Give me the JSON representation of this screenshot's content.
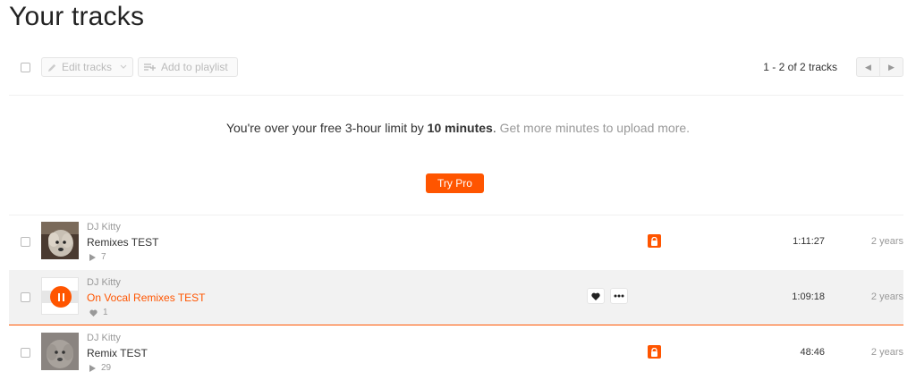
{
  "page": {
    "title": "Your tracks"
  },
  "toolbar": {
    "edit_tracks_label": "Edit tracks",
    "add_to_playlist_label": "Add to playlist",
    "count_label": "1 - 2 of 2 tracks"
  },
  "notice": {
    "prefix": "You're over your free 3-hour limit by ",
    "amount": "10 minutes",
    "suffix": ".",
    "link": "Get more minutes to upload more."
  },
  "cta": {
    "label": "Try Pro"
  },
  "colors": {
    "accent": "#ff5500",
    "muted": "#999999",
    "row_active_bg": "#f2f2f2"
  },
  "tracks": [
    {
      "artist": "DJ Kitty",
      "title": "Remixes TEST",
      "stat_icon": "play-icon",
      "stat": "7",
      "private": true,
      "duration": "1:11:27",
      "age": "2 years",
      "playing": false
    },
    {
      "artist": "DJ Kitty",
      "title": "On Vocal Remixes TEST",
      "stat_icon": "heart-icon",
      "stat": "1",
      "private": false,
      "duration": "1:09:18",
      "age": "2 years",
      "playing": true
    },
    {
      "artist": "DJ Kitty",
      "title": "Remix TEST",
      "stat_icon": "play-icon",
      "stat": "29",
      "private": true,
      "duration": "48:46",
      "age": "2 years",
      "playing": false
    }
  ]
}
